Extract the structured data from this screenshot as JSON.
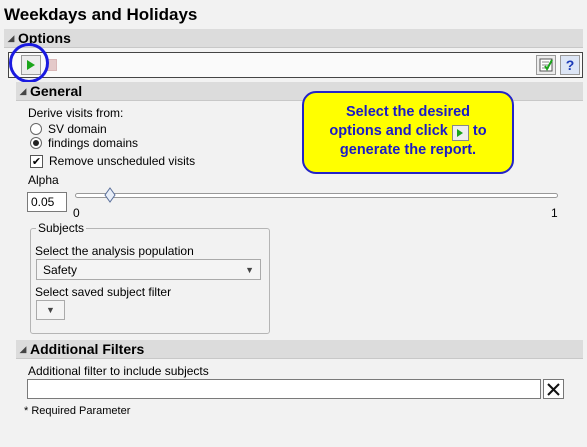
{
  "window": {
    "title": "Weekdays and Holidays"
  },
  "sections": {
    "options": "Options",
    "general": "General",
    "additional": "Additional Filters"
  },
  "general": {
    "derive_label": "Derive visits from:",
    "radio_sv": "SV domain",
    "radio_findings": "findings domains",
    "selected": "findings domains",
    "remove_unscheduled": "Remove unscheduled visits",
    "alpha_label": "Alpha",
    "alpha_value": "0.05",
    "slider_min": "0",
    "slider_max": "1",
    "slider_value": 0.05
  },
  "subjects": {
    "legend": "Subjects",
    "population_label": "Select the analysis population",
    "population_value": "Safety",
    "filter_label": "Select saved subject filter",
    "filter_value": ""
  },
  "callout": {
    "line1": "Select the desired",
    "line2a": "options and click",
    "line2b": "to",
    "line3": "generate the report."
  },
  "additional": {
    "filter_label": "Additional filter to include subjects",
    "filter_value": "",
    "required_note": "* Required Parameter"
  },
  "colors": {
    "accent": "#1a1ae0",
    "callout_bg": "#ffff00",
    "run_green": "#1aa51a"
  }
}
